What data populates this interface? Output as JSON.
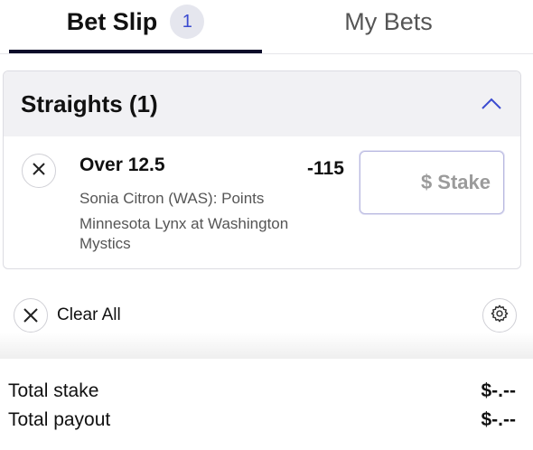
{
  "tabs": {
    "bet_slip_label": "Bet Slip",
    "bet_slip_count": "1",
    "my_bets_label": "My Bets"
  },
  "section": {
    "title": "Straights (1)"
  },
  "bet": {
    "selection": "Over 12.5",
    "odds": "-115",
    "market": "Sonia Citron (WAS): Points",
    "event": "Minnesota Lynx at Washington Mystics",
    "stake_placeholder": "$ Stake"
  },
  "actions": {
    "clear_all_label": "Clear All"
  },
  "totals": {
    "stake_label": "Total stake",
    "stake_value": "$-.--",
    "payout_label": "Total payout",
    "payout_value": "$-.--"
  },
  "icons": {
    "remove": "close-icon",
    "collapse": "chevron-up-icon",
    "clear": "close-icon",
    "settings": "gear-icon"
  },
  "colors": {
    "accent": "#3b4bd0",
    "tab_underline": "#0b0b2a",
    "header_bg": "#f1f1f4"
  }
}
